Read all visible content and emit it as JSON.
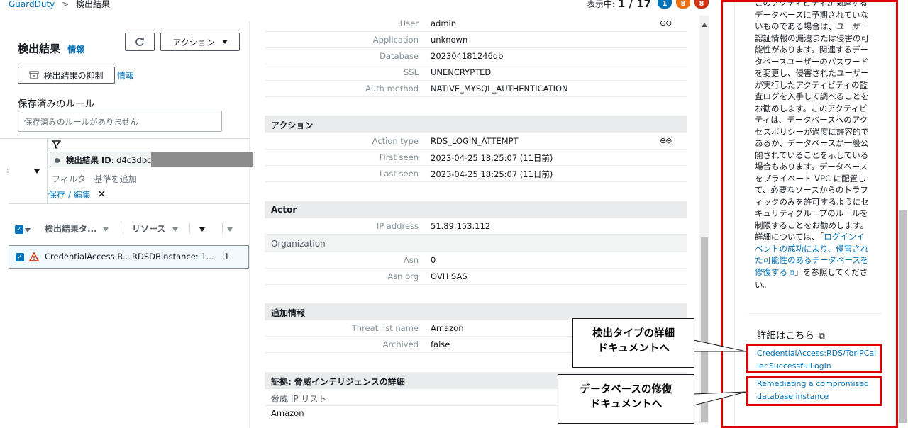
{
  "breadcrumb": {
    "root": "GuardDuty",
    "current": "検出結果"
  },
  "counter": {
    "label": "表示中:",
    "value": "1 / 17",
    "badges": [
      "1",
      "8",
      "8"
    ]
  },
  "left": {
    "title": "検出結果",
    "info": "情報",
    "refresh_icon": "refresh-icon",
    "actions": "アクション",
    "suppress": "検出結果の抑制",
    "suppress_info": "情報",
    "saved_rules_label": "保存済みのルール",
    "saved_rules_placeholder": "保存済みのルールがありません",
    "filter_token_label": "検出結果 ID",
    "filter_token_value": ": d4c3dbc",
    "add_filter_placeholder": "フィルター基準を追加",
    "save_edit": "保存 / 編集",
    "columns": [
      "検出結果タ...",
      "リソース"
    ],
    "row": {
      "type": "CredentialAccess:R...",
      "resource": "RDSDBInstance: 1...",
      "count": "1"
    }
  },
  "detail": {
    "rows_top": [
      {
        "key": "User",
        "value": "admin"
      },
      {
        "key": "Application",
        "value": "unknown"
      },
      {
        "key": "Database",
        "value": "202304181246db"
      },
      {
        "key": "SSL",
        "value": "UNENCRYPTED"
      },
      {
        "key": "Auth method",
        "value": "NATIVE_MYSQL_AUTHENTICATION"
      }
    ],
    "action_title": "アクション",
    "action_rows": [
      {
        "key": "Action type",
        "value": "RDS_LOGIN_ATTEMPT"
      },
      {
        "key": "First seen",
        "value": "2023-04-25 18:25:07 (11日前)"
      },
      {
        "key": "Last seen",
        "value": "2023-04-25 18:25:07 (11日前)"
      }
    ],
    "actor_title": "Actor",
    "actor_rows": [
      {
        "key": "IP address",
        "value": "51.89.153.112"
      }
    ],
    "org_title": "Organization",
    "org_rows": [
      {
        "key": "Asn",
        "value": "0"
      },
      {
        "key": "Asn org",
        "value": "OVH SAS"
      }
    ],
    "extra_title": "追加情報",
    "extra_rows": [
      {
        "key": "Threat list name",
        "value": "Amazon"
      },
      {
        "key": "Archived",
        "value": "false"
      }
    ],
    "threat_title": "証拠: 脅威インテリジェンスの詳細",
    "threat_sub": "脅威 IP リスト",
    "threat_value": "Amazon"
  },
  "help": {
    "lines": [
      "このアクティビティが関連する",
      "データベースに予期されていな",
      "いものである場合は、ユーザー",
      "認証情報の漏洩または侵害の可",
      "能性があります。関連するデー",
      "タベースユーザーのパスワード",
      "を変更し、侵害されたユーザー",
      "が実行したアクティビティの監",
      "査ログを入手して調べることを",
      "お勧めします。このアクティビ",
      "ティは、データベースへのアク",
      "セスポリシーが過度に許容的で",
      "あるか、データベースが一般公",
      "開されていることを示している",
      "場合もあります。データベース",
      "をプライベート VPC に配置し",
      "て、必要なソースからのトラフ",
      "ィックのみを許可するようにセ",
      "キュリティグループのルールを",
      "制限することをお勧めします。"
    ],
    "detail_prefix": "詳細については、「",
    "detail_link_lines": [
      "ログインイ",
      "ベントの成功により、侵害され",
      "た可能性のあるデータベースを",
      "修復する"
    ],
    "detail_suffix_1": "」を参照してくださ",
    "detail_suffix_2": "い。",
    "more_title": "詳細はこちら",
    "link1_lines": [
      "CredentialAccess:RDS/TorIPCal",
      "ler.SuccessfulLogin"
    ],
    "link2_lines": [
      "Remediating a compromised",
      "database instance"
    ]
  },
  "callouts": {
    "c1": [
      "検出タイプの詳細",
      "ドキュメントへ"
    ],
    "c2": [
      "データベースの修復",
      "ドキュメントへ"
    ]
  },
  "colors": {
    "accent": "#0073bb",
    "highlight": "#e00000",
    "badge_blue": "#0073bb",
    "badge_orange": "#ec7211",
    "badge_red": "#d13212"
  }
}
